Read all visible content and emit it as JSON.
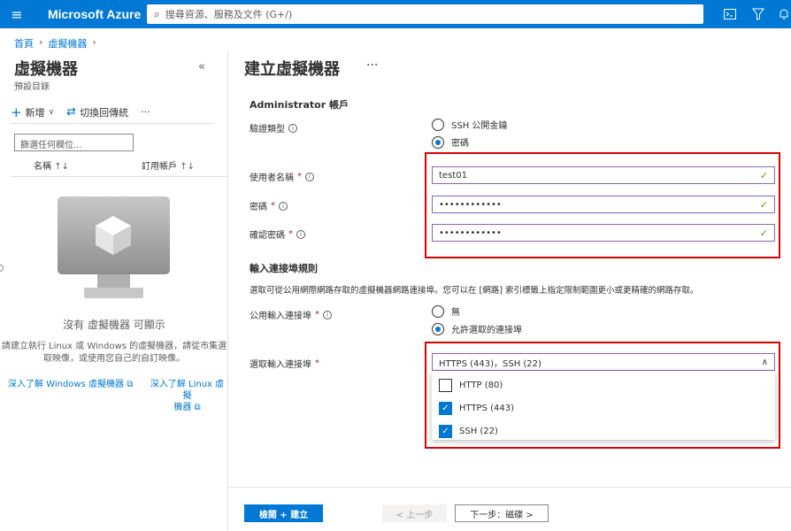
{
  "topbar": {
    "brand": "Microsoft Azure",
    "search_placeholder": "搜尋資源、服務及文件 (G+/)",
    "icons": [
      "hamburger-icon",
      "search-icon",
      "cloud-shell-icon",
      "directory-filter-icon",
      "notifications-icon"
    ]
  },
  "breadcrumb": [
    "首頁",
    "虛擬機器"
  ],
  "left": {
    "title": "虛擬機器",
    "subtitle": "預設目錄",
    "toolbar": {
      "new": "新增",
      "switch": "切換回傳統",
      "more": "···"
    },
    "filter_placeholder": "篩選任何欄位...",
    "columns": [
      "名稱",
      "訂用帳戶"
    ],
    "empty_title": "沒有 虛擬機器 可顯示",
    "empty_desc_1": "請建立執行 Linux 或 Windows 的虛擬機器，請從市集選",
    "empty_desc_2": "取映像，或使用您自己的自訂映像。",
    "learn_windows": "深入了解 Windows 虛擬機器",
    "learn_linux_1": "深入了解 Linux 虛擬",
    "learn_linux_2": "機器"
  },
  "right": {
    "title": "建立虛擬機器",
    "more": "···",
    "admin_section": "Administrator 帳戶",
    "auth_type_label": "驗證類型",
    "auth_options": [
      "SSH 公開金鑰",
      "密碼"
    ],
    "auth_selected": "密碼",
    "username_label": "使用者名稱",
    "username_value": "test01",
    "password_label": "密碼",
    "password_value": "••••••••••••",
    "confirm_label": "確認密碼",
    "confirm_value": "••••••••••••",
    "inbound_section": "輸入連接埠規則",
    "inbound_desc": "選取可從公用網際網路存取的虛擬機器網路連接埠。您可以在 [網路] 索引標籤上指定限制範圍更小或更精確的網路存取。",
    "public_ports_label": "公用輸入連接埠",
    "public_ports_options": [
      "無",
      "允許選取的連接埠"
    ],
    "public_ports_selected": "允許選取的連接埠",
    "select_ports_label": "選取輸入連接埠",
    "select_ports_value": "HTTPS (443)，SSH (22)",
    "port_options": [
      {
        "label": "HTTP (80)",
        "checked": false
      },
      {
        "label": "HTTPS (443)",
        "checked": true
      },
      {
        "label": "SSH (22)",
        "checked": true
      }
    ]
  },
  "footer": {
    "review_create": "檢閱 + 建立",
    "previous": "< 上一步",
    "next": "下一步：磁碟 >"
  },
  "colors": {
    "accent": "#0078d4",
    "highlight_box": "#e00000",
    "valid_check": "#57a300"
  }
}
